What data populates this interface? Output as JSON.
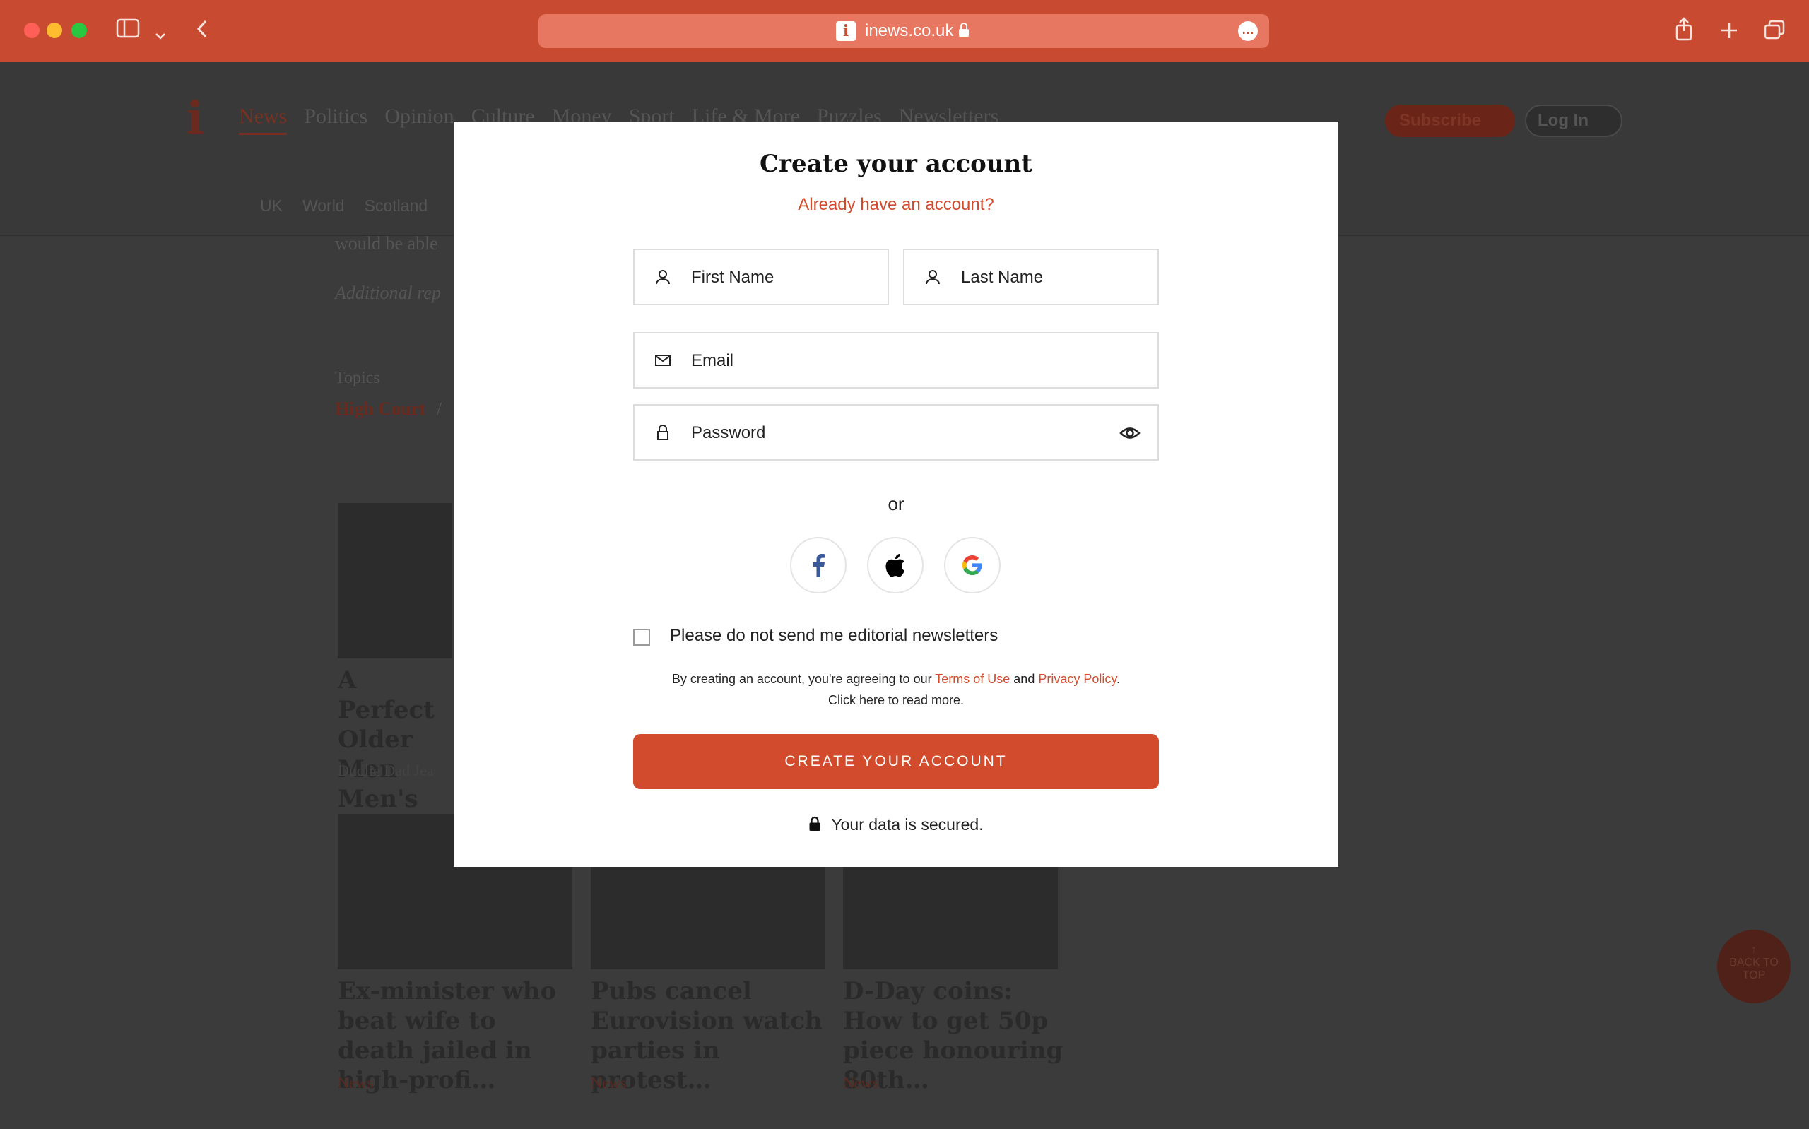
{
  "browser": {
    "url": "inews.co.uk",
    "site_icon": "i",
    "more_glyph": "…"
  },
  "site": {
    "logo": "i",
    "nav": [
      "News",
      "Politics",
      "Opinion",
      "Culture",
      "Money",
      "Sport",
      "Life & More",
      "Puzzles",
      "Newsletters"
    ],
    "subnav": [
      "UK",
      "World",
      "Scotland"
    ],
    "subscribe_label": "Subscribe",
    "login_label": "Log In",
    "article_snippet": "would be able",
    "additional_reporting": "Additional rep",
    "topics_label": "Topics",
    "topic_1": "High Court",
    "topic_sep": "/",
    "cards_top": {
      "headline_1": "A Perfect",
      "headline_2": "Older Men",
      "headline_3": "Men's Dail",
      "source": "Dudlie Dad Jea"
    },
    "cards": [
      {
        "headline": "Ex-minister who beat wife to death jailed in high-profi…",
        "tag": "News"
      },
      {
        "headline": "Pubs cancel Eurovision watch parties in protest…",
        "tag": "News"
      },
      {
        "headline": "D-Day coins: How to get 50p piece honouring 80th…",
        "tag": "News"
      }
    ],
    "back_to_top": "BACK TO TOP"
  },
  "modal": {
    "title": "Create your account",
    "signin_link": "Already have an account?",
    "first_name_placeholder": "First Name",
    "last_name_placeholder": "Last Name",
    "email_placeholder": "Email",
    "password_placeholder": "Password",
    "or_text": "or",
    "newsletter_opt_out": "Please do not send me editorial newsletters",
    "legal_prefix": "By creating an account, you're agreeing to our ",
    "terms_link": "Terms of Use",
    "legal_and": " and ",
    "privacy_link": "Privacy Policy",
    "legal_suffix": ".",
    "read_more": "Click here to read more.",
    "cta_label": "CREATE YOUR ACCOUNT",
    "secured_text": "Your data is secured."
  },
  "colors": {
    "brand": "#d14b2c",
    "chrome": "#c84b31"
  }
}
